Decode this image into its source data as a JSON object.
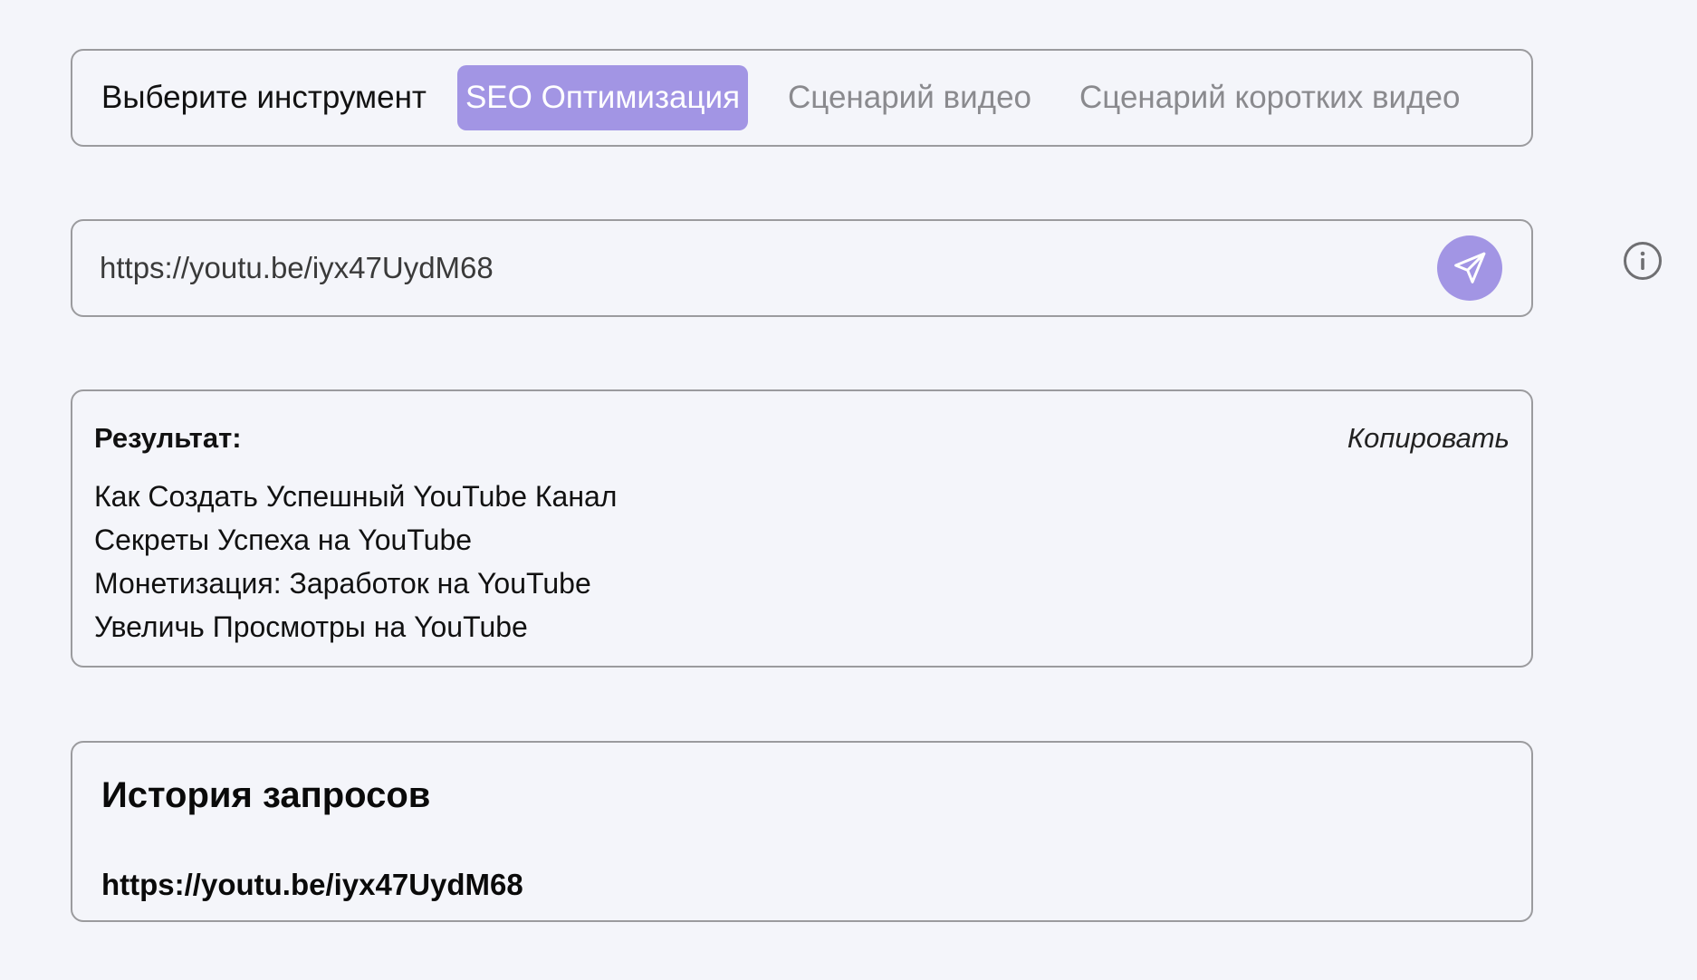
{
  "tool_selector": {
    "label": "Выберите инструмент",
    "tabs": [
      {
        "label": "SEO Оптимизация",
        "active": true
      },
      {
        "label": "Сценарий видео",
        "active": false
      },
      {
        "label": "Сценарий коротких видео",
        "active": false
      }
    ]
  },
  "url_input": {
    "value": "https://youtu.be/iyx47UydM68",
    "send_icon": "send-icon"
  },
  "info_icon": "info-icon",
  "result": {
    "title": "Результат:",
    "copy_label": "Копировать",
    "items": [
      "Как Создать Успешный YouTube Канал",
      "Секреты Успеха на YouTube",
      "Монетизация: Заработок на YouTube",
      "Увеличь Просмотры на YouTube"
    ]
  },
  "history": {
    "title": "История запросов",
    "items": [
      {
        "url": "https://youtu.be/iyx47UydM68"
      }
    ]
  },
  "colors": {
    "accent": "#a295e4",
    "background": "#f4f5fa",
    "border": "#9b9b9e",
    "inactive_tab": "#8a8a8e"
  }
}
